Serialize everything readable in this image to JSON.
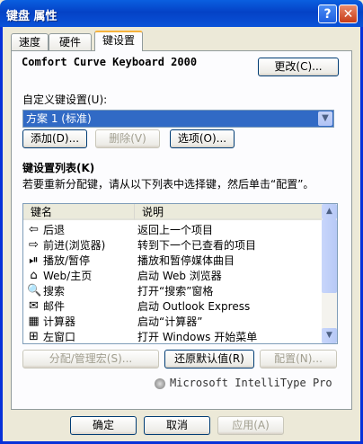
{
  "window": {
    "title": "键盘 属性",
    "help_glyph": "?",
    "close_glyph": "✕"
  },
  "tabs": [
    {
      "label": "速度"
    },
    {
      "label": "硬件"
    },
    {
      "label": "键设置"
    }
  ],
  "keyboard": {
    "name": "Comfort Curve Keyboard 2000",
    "change_button": "更改(C)..."
  },
  "custom": {
    "label": "自定义键设置(U):",
    "selected": "方案 1 (标准)",
    "add_button": "添加(D)...",
    "delete_button": "删除(V)",
    "options_button": "选项(O)..."
  },
  "keylist": {
    "title": "键设置列表(K)",
    "instruction": "若要重新分配键，请从以下列表中选择键，然后单击“配置”。",
    "col_key": "键名",
    "col_desc": "说明",
    "rows": [
      {
        "icon": "back-arrow-icon",
        "glyph": "⇦",
        "key": "后退",
        "desc": "返回上一个项目"
      },
      {
        "icon": "forward-arrow-icon",
        "glyph": "⇨",
        "key": "前进(浏览器)",
        "desc": "转到下一个已查看的项目"
      },
      {
        "icon": "play-pause-icon",
        "glyph": "⏯",
        "key": "播放/暂停",
        "desc": "播放和暂停媒体曲目"
      },
      {
        "icon": "home-icon",
        "glyph": "⌂",
        "key": "Web/主页",
        "desc": "启动 Web 浏览器"
      },
      {
        "icon": "search-icon",
        "glyph": "🔍",
        "key": "搜索",
        "desc": "打开“搜索”窗格"
      },
      {
        "icon": "mail-icon",
        "glyph": "✉",
        "key": "邮件",
        "desc": "启动 Outlook Express"
      },
      {
        "icon": "calculator-icon",
        "glyph": "▦",
        "key": "计算器",
        "desc": "启动“计算器”"
      },
      {
        "icon": "windows-logo-icon",
        "glyph": "⊞",
        "key": "左窗口",
        "desc": "打开 Windows 开始菜单"
      }
    ],
    "assign_button": "分配/管理宏(S)...",
    "restore_button": "还原默认值(R)",
    "configure_button": "配置(N)..."
  },
  "brand": "Microsoft IntelliType Pro",
  "footer": {
    "ok": "确定",
    "cancel": "取消",
    "apply": "应用(A)"
  }
}
